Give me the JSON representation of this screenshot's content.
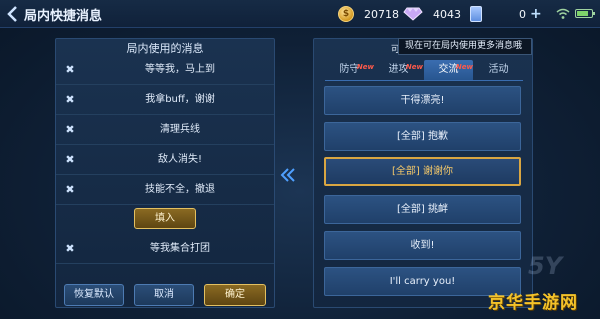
{
  "header": {
    "title": "局内快捷消息",
    "gold": "20718",
    "gems": "4043",
    "tickets": "0"
  },
  "left_panel": {
    "title": "局内使用的消息",
    "messages": [
      "等等我，马上到",
      "我拿buff，谢谢",
      "清理兵线",
      "敌人消失!",
      "技能不全，撤退"
    ],
    "insert_label": "填入",
    "extra_message": "等我集合打团"
  },
  "buttons": {
    "reset": "恢复默认",
    "cancel": "取消",
    "confirm": "确定"
  },
  "right_panel": {
    "tooltip_prefix": "可",
    "tooltip": "现在可在局内使用更多消息哦",
    "tabs": [
      {
        "label": "防守",
        "badge": "New",
        "active": false
      },
      {
        "label": "进攻",
        "badge": "New",
        "active": false
      },
      {
        "label": "交流",
        "badge": "New",
        "active": true
      },
      {
        "label": "活动",
        "badge": "",
        "active": false
      }
    ],
    "messages": [
      "干得漂亮!",
      "[全部] 抱歉",
      "[全部] 谢谢你",
      "[全部] 挑衅",
      "收到!",
      "I'll carry you!"
    ],
    "selected_index": 2
  },
  "watermark": "京华手游网",
  "colors": {
    "gold_accent": "#d9a642",
    "tab_active": "#3a6db0",
    "new_badge": "#ff5a4a"
  }
}
